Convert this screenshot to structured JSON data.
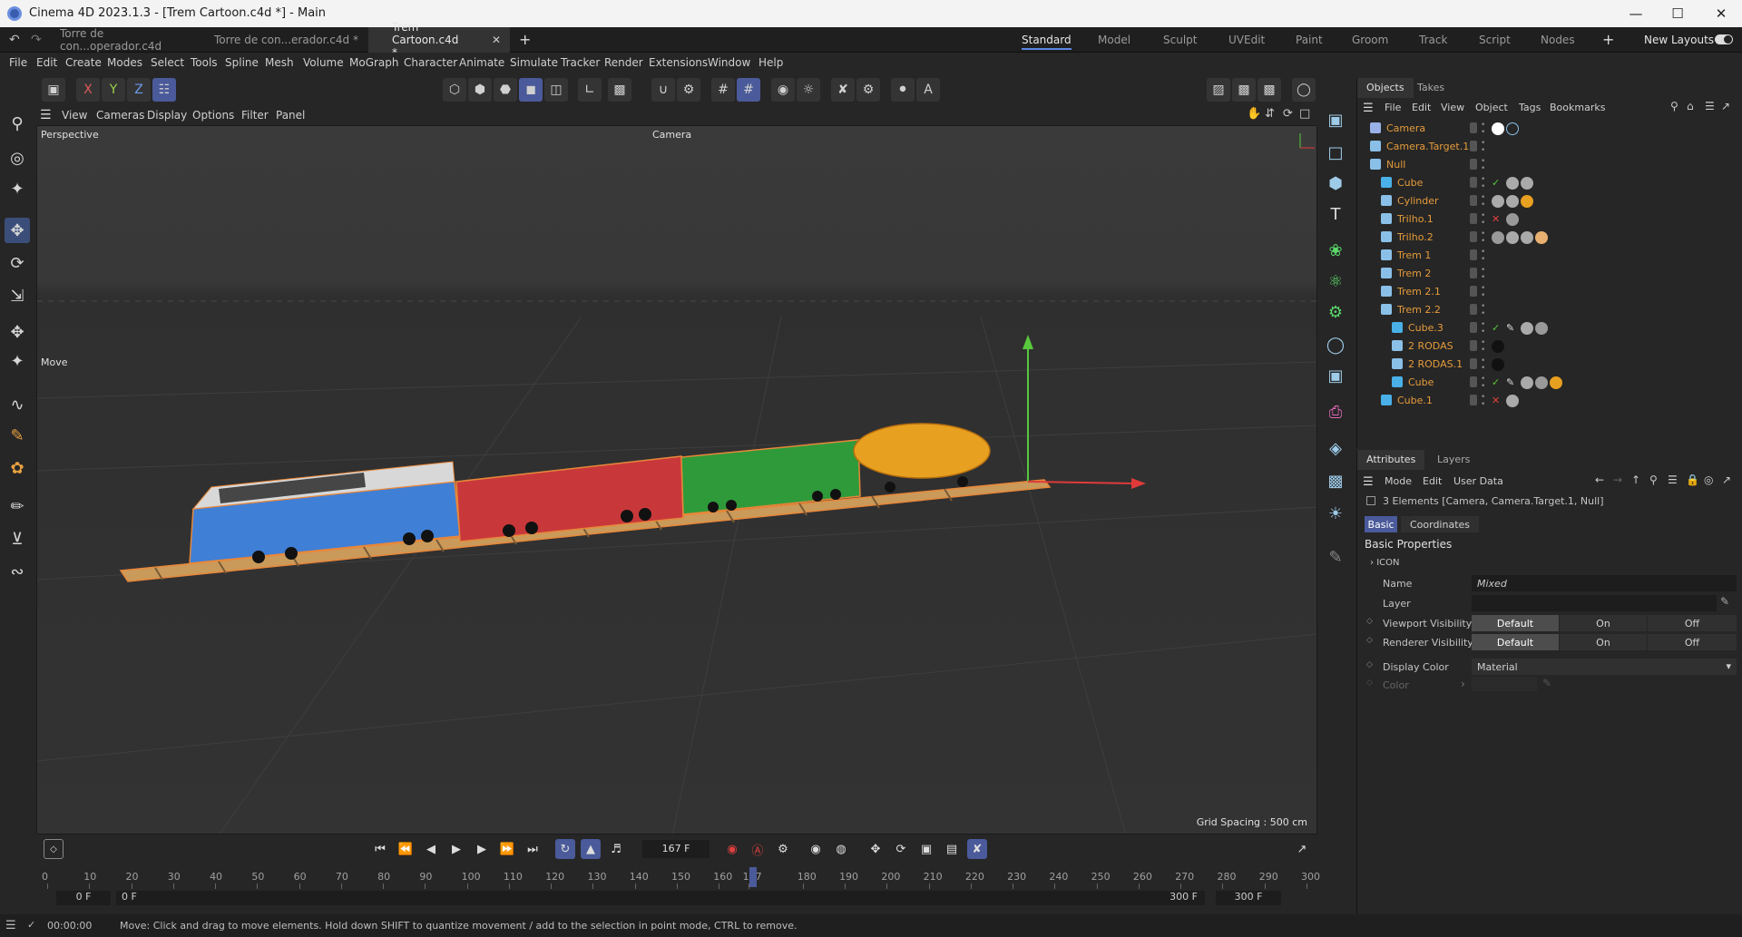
{
  "window": {
    "title": "Cinema 4D 2023.1.3 - [Trem Cartoon.c4d *] - Main"
  },
  "doc_tabs": [
    {
      "label": "Torre de con...operador.c4d"
    },
    {
      "label": "Torre de con...erador.c4d *"
    },
    {
      "label": "Trem Cartoon.c4d *"
    }
  ],
  "layouts": [
    "Standard",
    "Model",
    "Sculpt",
    "UVEdit",
    "Paint",
    "Groom",
    "Track",
    "Script",
    "Nodes"
  ],
  "new_layouts": "New Layouts",
  "menus": [
    "File",
    "Edit",
    "Create",
    "Modes",
    "Select",
    "Tools",
    "Spline",
    "Mesh",
    "Volume",
    "MoGraph",
    "Character",
    "Animate",
    "Simulate",
    "Tracker",
    "Render",
    "Extensions",
    "Window",
    "Help"
  ],
  "axis_buttons": [
    "X",
    "Y",
    "Z"
  ],
  "viewport_menu": [
    "View",
    "Cameras",
    "Display",
    "Options",
    "Filter",
    "Panel"
  ],
  "viewport": {
    "projection": "Perspective",
    "camera": "Camera",
    "tool": "Move",
    "grid_spacing": "Grid Spacing : 500 cm"
  },
  "objects_tabs": [
    "Objects",
    "Takes"
  ],
  "objects_menu": [
    "File",
    "Edit",
    "View",
    "Object",
    "Tags",
    "Bookmarks"
  ],
  "objects": [
    {
      "name": "Camera",
      "indent": 0,
      "icon": "camera-icon",
      "color": "#e59b3a"
    },
    {
      "name": "Camera.Target.1",
      "indent": 0,
      "icon": "null-icon",
      "color": "#e59b3a"
    },
    {
      "name": "Null",
      "indent": 0,
      "icon": "null-icon",
      "color": "#e59b3a"
    },
    {
      "name": "Cube",
      "indent": 1,
      "icon": "cube-icon",
      "color": "#e59b3a"
    },
    {
      "name": "Cylinder",
      "indent": 1,
      "icon": "cylinder-icon",
      "color": "#e59b3a"
    },
    {
      "name": "Trilho.1",
      "indent": 1,
      "icon": "cloner-icon",
      "color": "#e59b3a"
    },
    {
      "name": "Trilho.2",
      "indent": 1,
      "icon": "cloner-icon",
      "color": "#e59b3a"
    },
    {
      "name": "Trem 1",
      "indent": 1,
      "icon": "null-icon",
      "color": "#e59b3a"
    },
    {
      "name": "Trem 2",
      "indent": 1,
      "icon": "null-icon",
      "color": "#e59b3a"
    },
    {
      "name": "Trem 2.1",
      "indent": 1,
      "icon": "null-icon",
      "color": "#e59b3a"
    },
    {
      "name": "Trem 2.2",
      "indent": 1,
      "icon": "null-icon",
      "color": "#e59b3a"
    },
    {
      "name": "Cube.3",
      "indent": 2,
      "icon": "cube-icon",
      "color": "#e59b3a"
    },
    {
      "name": "2 RODAS",
      "indent": 2,
      "icon": "null-icon",
      "color": "#e59b3a"
    },
    {
      "name": "2 RODAS.1",
      "indent": 2,
      "icon": "null-icon",
      "color": "#e59b3a"
    },
    {
      "name": "Cube",
      "indent": 2,
      "icon": "cube-icon",
      "color": "#e59b3a"
    },
    {
      "name": "Cube.1",
      "indent": 1,
      "icon": "cube-icon",
      "color": "#e59b3a"
    }
  ],
  "attributes": {
    "tabs": [
      "Attributes",
      "Layers"
    ],
    "menu": [
      "Mode",
      "Edit",
      "User Data"
    ],
    "selection": "3 Elements [Camera, Camera.Target.1, Null]",
    "subtabs": [
      "Basic",
      "Coordinates"
    ],
    "section": "Basic Properties",
    "icon_group": "ICON",
    "name_label": "Name",
    "name_value": "Mixed",
    "layer_label": "Layer",
    "viewport_vis_label": "Viewport Visibility",
    "renderer_vis_label": "Renderer Visibility",
    "vis_options": [
      "Default",
      "On",
      "Off"
    ],
    "display_color_label": "Display Color",
    "display_color_value": "Material",
    "color_label": "Color"
  },
  "timeline": {
    "current_frame": "167 F",
    "ruler": [
      "0",
      "10",
      "20",
      "30",
      "40",
      "50",
      "60",
      "70",
      "80",
      "90",
      "100",
      "110",
      "120",
      "130",
      "140",
      "150",
      "160",
      "167",
      "180",
      "190",
      "200",
      "210",
      "220",
      "230",
      "240",
      "250",
      "260",
      "270",
      "280",
      "290",
      "300"
    ],
    "start": "0 F",
    "start2": "0 F",
    "end": "300 F",
    "end2": "300 F"
  },
  "status": {
    "time": "00:00:00",
    "message": "Move: Click and drag to move elements. Hold down SHIFT to quantize movement / add to the selection in point mode, CTRL to remove."
  },
  "colors": {
    "accent": "#5a87e0",
    "object_name": "#e59b3a",
    "selection": "#e8873a"
  }
}
